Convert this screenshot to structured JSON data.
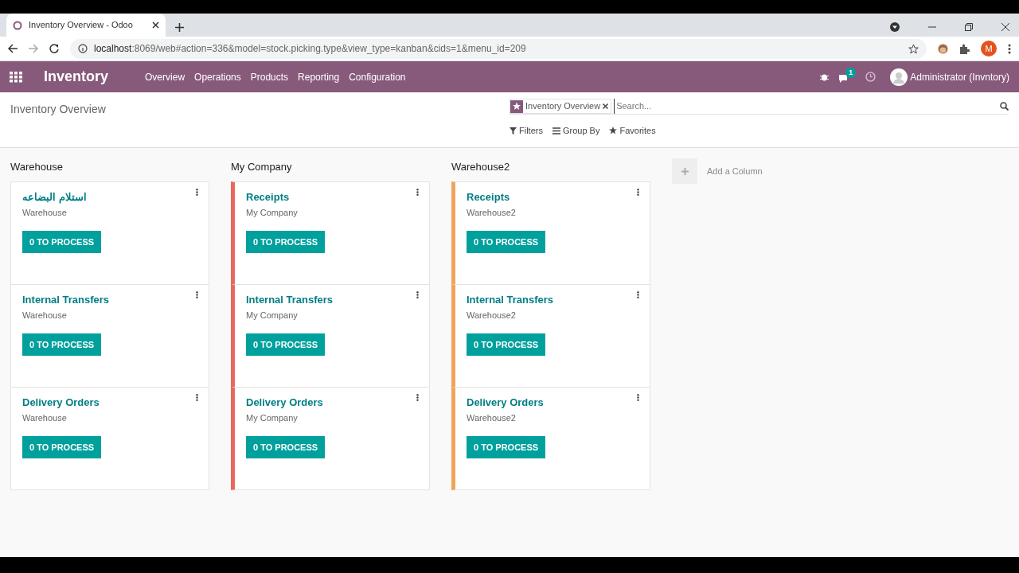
{
  "browser": {
    "tab_title": "Inventory Overview - Odoo",
    "url_host": "localhost",
    "url_rest": ":8069/web#action=336&model=stock.picking.type&view_type=kanban&cids=1&menu_id=209",
    "profile_initial": "M"
  },
  "navbar": {
    "app": "Inventory",
    "menu": [
      "Overview",
      "Operations",
      "Products",
      "Reporting",
      "Configuration"
    ],
    "message_count": "1",
    "user": "Administrator (Invntory)"
  },
  "control_panel": {
    "breadcrumb": "Inventory Overview",
    "facet": "Inventory Overview",
    "placeholder": "Search...",
    "filters": [
      "Filters",
      "Group By",
      "Favorites"
    ]
  },
  "columns": [
    {
      "title": "Warehouse",
      "cards": [
        {
          "name": "استلام البضاعه",
          "company": "Warehouse",
          "button": "0 TO PROCESS"
        },
        {
          "name": "Internal Transfers",
          "company": "Warehouse",
          "button": "0 TO PROCESS"
        },
        {
          "name": "Delivery Orders",
          "company": "Warehouse",
          "button": "0 TO PROCESS"
        }
      ]
    },
    {
      "title": "My Company",
      "color": "#e8685c",
      "cards": [
        {
          "name": "Receipts",
          "company": "My Company",
          "button": "0 TO PROCESS"
        },
        {
          "name": "Internal Transfers",
          "company": "My Company",
          "button": "0 TO PROCESS"
        },
        {
          "name": "Delivery Orders",
          "company": "My Company",
          "button": "0 TO PROCESS"
        }
      ]
    },
    {
      "title": "Warehouse2",
      "color": "#f0a35a",
      "cards": [
        {
          "name": "Receipts",
          "company": "Warehouse2",
          "button": "0 TO PROCESS"
        },
        {
          "name": "Internal Transfers",
          "company": "Warehouse2",
          "button": "0 TO PROCESS"
        },
        {
          "name": "Delivery Orders",
          "company": "Warehouse2",
          "button": "0 TO PROCESS"
        }
      ]
    }
  ],
  "add_column": "Add a Column"
}
